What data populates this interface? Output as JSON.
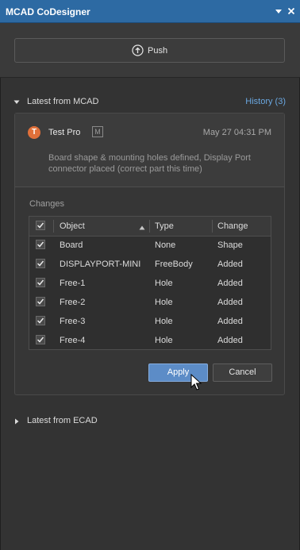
{
  "window": {
    "title": "MCAD CoDesigner",
    "menu_icon": "dropdown-arrow-icon",
    "close_icon": "close-icon"
  },
  "push": {
    "label": "Push",
    "icon": "push-arrow-icon"
  },
  "mcad": {
    "section_title": "Latest from MCAD",
    "history_link": "History (3)",
    "commit": {
      "avatar_initial": "T",
      "avatar_color": "#e0703a",
      "author": "Test Pro",
      "badge": "M",
      "date": "May 27 04:31 PM",
      "message": "Board shape & mounting holes defined, Display Port connector placed (correct part this time)"
    },
    "changes": {
      "label": "Changes",
      "columns": {
        "object": "Object",
        "type": "Type",
        "change": "Change"
      },
      "rows": [
        {
          "object": "Board",
          "type": "None",
          "change": "Shape",
          "checked": true
        },
        {
          "object": "DISPLAYPORT-MINI",
          "type": "FreeBody",
          "change": "Added",
          "checked": true
        },
        {
          "object": "Free-1",
          "type": "Hole",
          "change": "Added",
          "checked": true
        },
        {
          "object": "Free-2",
          "type": "Hole",
          "change": "Added",
          "checked": true
        },
        {
          "object": "Free-3",
          "type": "Hole",
          "change": "Added",
          "checked": true
        },
        {
          "object": "Free-4",
          "type": "Hole",
          "change": "Added",
          "checked": true
        }
      ]
    },
    "apply_label": "Apply",
    "cancel_label": "Cancel"
  },
  "ecad": {
    "section_title": "Latest from ECAD"
  },
  "colors": {
    "titlebar": "#2d6aa3",
    "accent_link": "#6aa7e0",
    "apply_button": "#5c8cc7"
  }
}
